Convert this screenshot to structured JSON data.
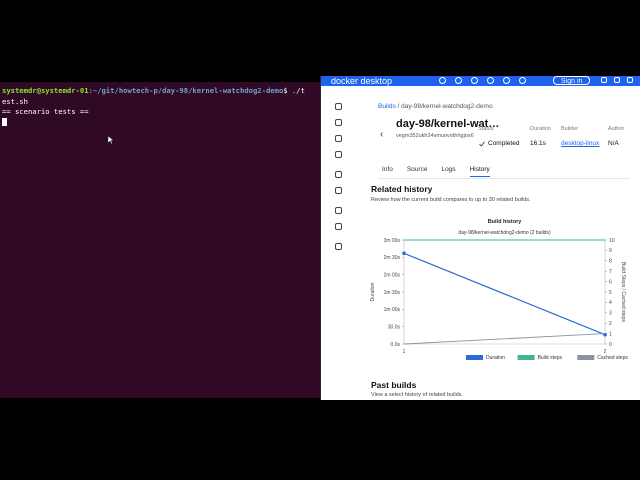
{
  "terminal": {
    "prompt_user": "systemdr@systemdr-01",
    "prompt_path": ":~/git/howtech-p/day-98/kernel-watchdog2-demo",
    "prompt_end": "$ ./t",
    "line2": "est.sh",
    "line3": "== scenario tests =="
  },
  "docker": {
    "brand": "docker desktop",
    "signin_label": "Sign in",
    "breadcrumb_root": "Builds",
    "breadcrumb_sep": "/",
    "breadcrumb_current": "day-98/kernel-watchdog2-demo",
    "build_title": "day-98/kernel-wat…",
    "build_id": "vegm352ukh24vmuovothhgjos6",
    "status_label": "Status",
    "status_value": "Completed",
    "duration_label": "Duration",
    "duration_value": "16.1s",
    "builder_label": "Builder",
    "builder_value": "desktop-linux",
    "author_label": "Author",
    "author_value": "N/A",
    "tabs": [
      "Info",
      "Source",
      "Logs",
      "History"
    ],
    "active_tab": "History",
    "related_title": "Related history",
    "related_desc": "Review how the current build compares to up to 30 related builds.",
    "past_title": "Past builds",
    "past_desc": "View a select history of related builds.",
    "colors": {
      "accent": "#1d63ed",
      "duration": "#2d6bd6",
      "build_steps": "#3fb68b",
      "cached_steps": "#8a93a6",
      "terminal_bg": "#300a24"
    }
  },
  "chart_data": {
    "type": "line",
    "title": "Build history",
    "subtitle": "day-98/kernel-watchdog2-demo (2 builds)",
    "x": [
      1,
      2
    ],
    "xticks": [
      "1",
      "2"
    ],
    "ylabel": "Duration",
    "y2label": "Build Steps / Cached steps",
    "yticks": [
      "0.0s",
      "30.0s",
      "1m 00s",
      "1m 30s",
      "2m 00s",
      "2m 30s",
      "3m 00s"
    ],
    "ylim": [
      0,
      180
    ],
    "y2ticks": [
      "0",
      "1",
      "2",
      "3",
      "4",
      "5",
      "6",
      "7",
      "8",
      "9",
      "10"
    ],
    "y2lim": [
      0,
      10
    ],
    "series": [
      {
        "name": "Duration",
        "axis": "left",
        "values": [
          157,
          16.1
        ]
      },
      {
        "name": "Build steps",
        "axis": "right",
        "values": [
          10,
          10
        ]
      },
      {
        "name": "Cached steps",
        "axis": "right",
        "values": [
          0,
          1
        ]
      }
    ],
    "legend": "bottom-right"
  }
}
